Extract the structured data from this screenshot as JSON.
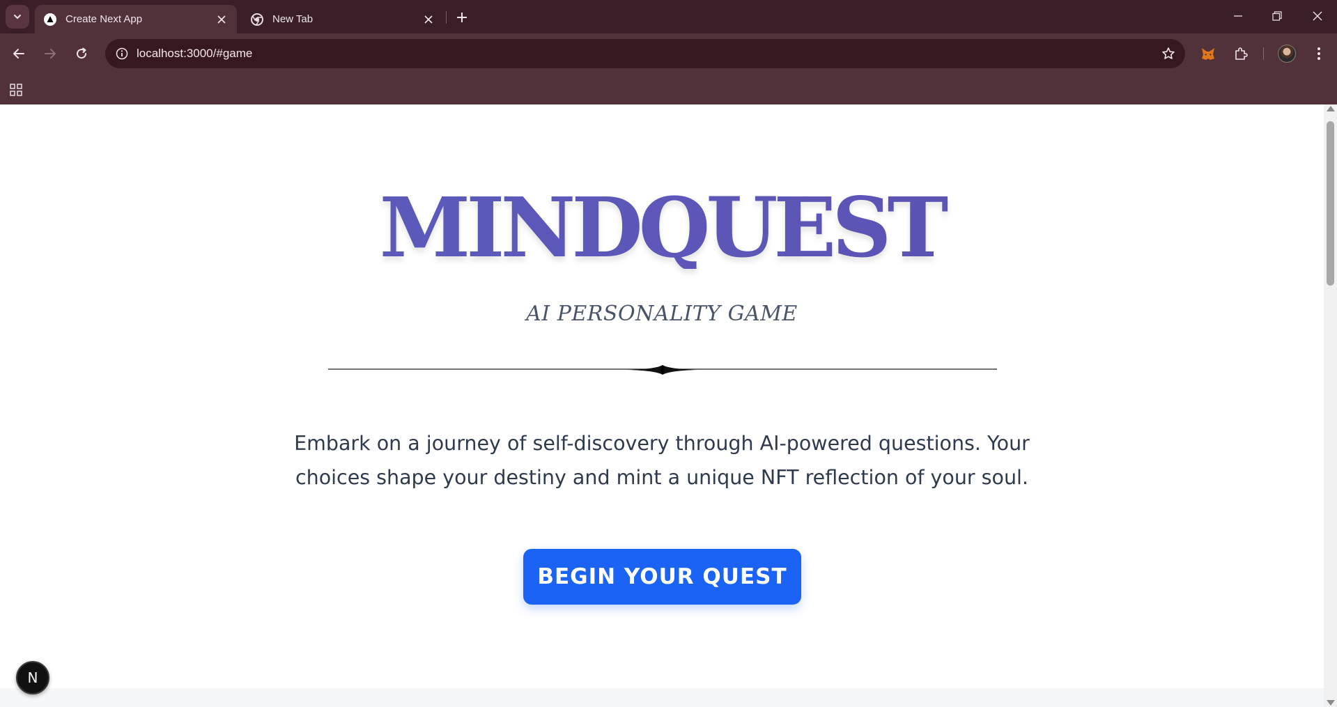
{
  "browser": {
    "tabs": [
      {
        "title": "Create Next App",
        "favicon": "nextjs-icon",
        "active": true
      },
      {
        "title": "New Tab",
        "favicon": "chrome-icon",
        "active": false
      }
    ],
    "url": "localhost:3000/#game",
    "colors": {
      "tabstrip": "#3a1f28",
      "toolbar": "#51323b",
      "omnibox": "#36191f"
    }
  },
  "page": {
    "title": "MINDQUEST",
    "subtitle": "AI PERSONALITY GAME",
    "description": "Embark on a journey of self-discovery through AI-powered questions. Your choices shape your destiny and mint a unique NFT reflection of your soul.",
    "cta_label": "BEGIN YOUR QUEST",
    "badge_label": "N",
    "colors": {
      "title": "#5b58b8",
      "cta": "#1a63f5",
      "text": "#2f3a4d"
    }
  }
}
